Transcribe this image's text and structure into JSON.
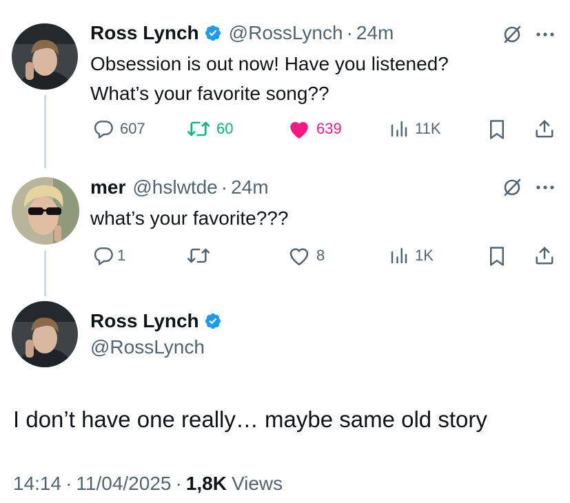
{
  "tweet1": {
    "name": "Ross Lynch",
    "handle": "@RossLynch",
    "separator": "·",
    "time": "24m",
    "text_line1": "Obsession is out now! Have you listened?",
    "text_line2": "What’s your favorite song??",
    "replies": "607",
    "retweets": "60",
    "likes": "639",
    "views": "11K"
  },
  "tweet2": {
    "name": "mer",
    "handle": "@hslwtde",
    "separator": "·",
    "time": "24m",
    "text": "what’s your favorite???",
    "replies": "1",
    "likes": "8",
    "views": "1K"
  },
  "main": {
    "name": "Ross Lynch",
    "handle": "@RossLynch",
    "text": "I don’t have one really… maybe same old story",
    "time": "14:14",
    "date": "11/04/2025",
    "separator": "·",
    "views_count": "1,8K",
    "views_label": "Views"
  },
  "colors": {
    "verified": "#1d9bf0",
    "retweet_active": "#00ba7c",
    "like_active": "#f91880",
    "muted": "#536471"
  }
}
